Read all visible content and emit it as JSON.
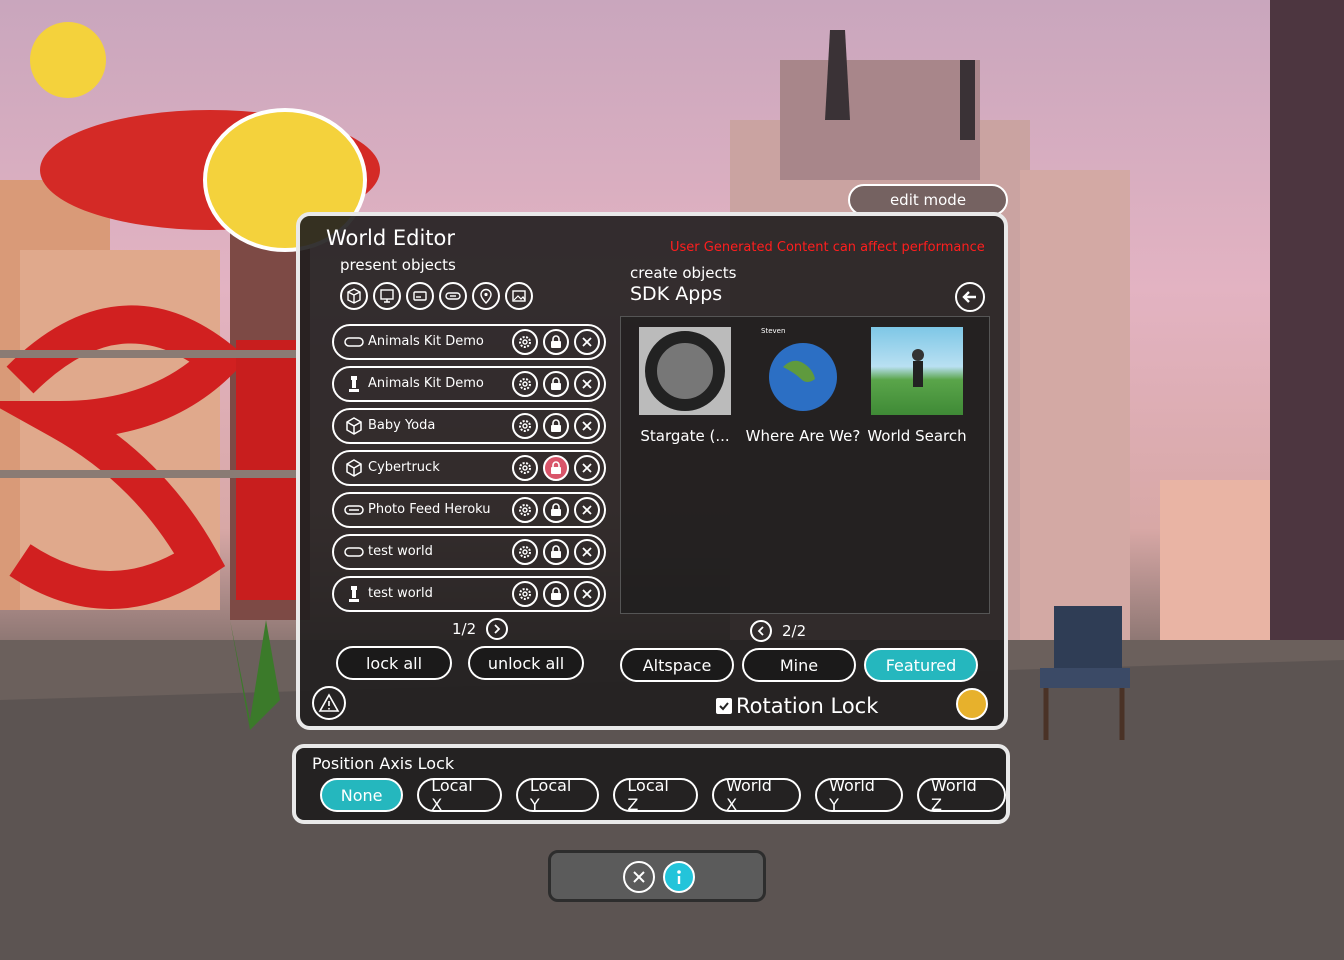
{
  "edit_mode_label": "edit mode",
  "editor": {
    "title": "World Editor",
    "present_label": "present objects",
    "warning": "User Generated Content can affect performance",
    "create_label": "create objects",
    "section_title": "SDK Apps",
    "filter_icons": [
      "cube-icon",
      "monitor-icon",
      "card-icon",
      "link-icon",
      "map-pin-icon",
      "image-icon"
    ],
    "objects": [
      {
        "label": "Animals Kit Demo",
        "icon": "link-icon",
        "locked": false
      },
      {
        "label": "Animals Kit Demo",
        "icon": "lamp-icon",
        "locked": false
      },
      {
        "label": "Baby Yoda",
        "icon": "cube-icon",
        "locked": false
      },
      {
        "label": "Cybertruck",
        "icon": "cube-icon",
        "locked": true
      },
      {
        "label": "Photo Feed Heroku",
        "icon": "link-icon",
        "locked": false
      },
      {
        "label": "test world",
        "icon": "link-icon",
        "locked": false
      },
      {
        "label": "test world",
        "icon": "lamp-icon",
        "locked": false
      }
    ],
    "list_page": "1/2",
    "apps": [
      {
        "label": "Stargate (..."
      },
      {
        "label": "Where Are We?",
        "caption": "Steven"
      },
      {
        "label": "World Search"
      }
    ],
    "apps_page": "2/2",
    "lock_all": "lock all",
    "unlock_all": "unlock all",
    "tabs": [
      {
        "label": "Altspace",
        "active": false
      },
      {
        "label": "Mine",
        "active": false
      },
      {
        "label": "Featured",
        "active": true
      }
    ],
    "rotation_lock": "Rotation Lock"
  },
  "axis_lock": {
    "title": "Position Axis Lock",
    "options": [
      {
        "label": "None",
        "active": true
      },
      {
        "label": "Local X",
        "active": false
      },
      {
        "label": "Local Y",
        "active": false
      },
      {
        "label": "Local Z",
        "active": false
      },
      {
        "label": "World X",
        "active": false
      },
      {
        "label": "World Y",
        "active": false
      },
      {
        "label": "World Z",
        "active": false
      }
    ]
  },
  "colors": {
    "accent": "#25b7be",
    "warning": "#ff1e1e",
    "lock_active": "#d9556a"
  }
}
